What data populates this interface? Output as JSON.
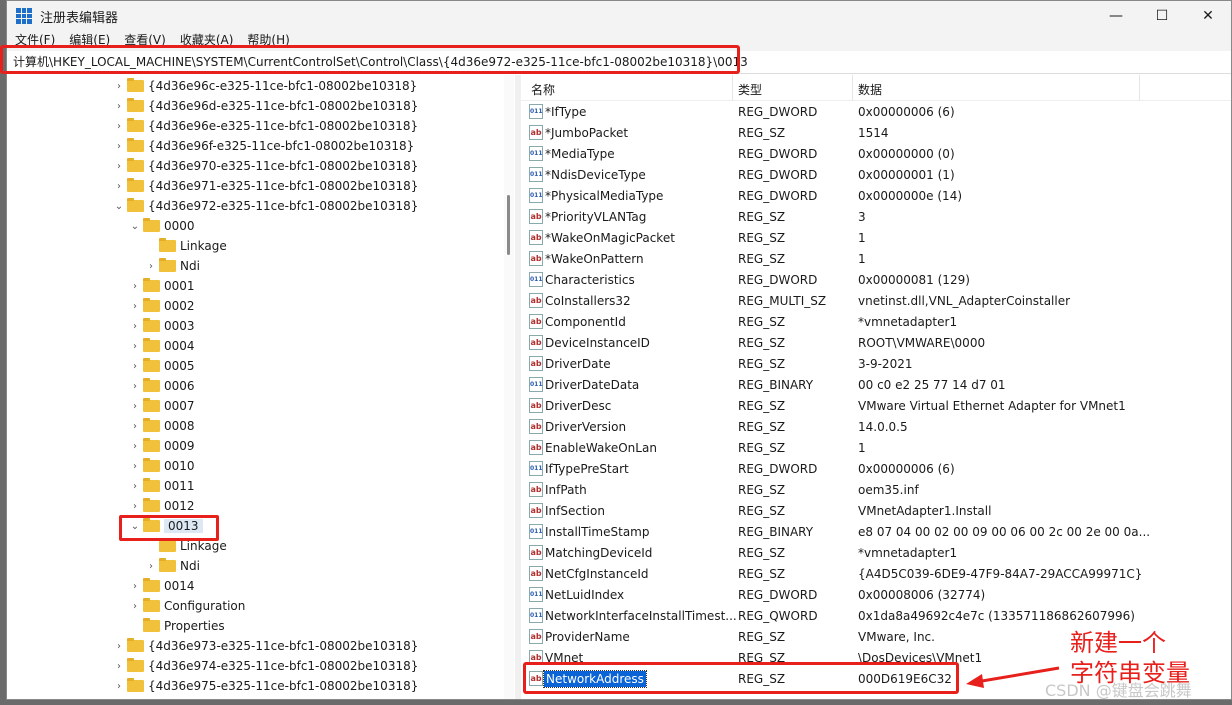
{
  "window": {
    "title": "注册表编辑器",
    "minimize": "—",
    "maximize": "☐",
    "close": "✕"
  },
  "menu": [
    "文件(F)",
    "编辑(E)",
    "查看(V)",
    "收藏夹(A)",
    "帮助(H)"
  ],
  "address": "计算机\\HKEY_LOCAL_MACHINE\\SYSTEM\\CurrentControlSet\\Control\\Class\\{4d36e972-e325-11ce-bfc1-08002be10318}\\0013",
  "tree": [
    {
      "label": "{4d36e96c-e325-11ce-bfc1-08002be10318}",
      "level": 1,
      "expanded": false
    },
    {
      "label": "{4d36e96d-e325-11ce-bfc1-08002be10318}",
      "level": 1,
      "expanded": false
    },
    {
      "label": "{4d36e96e-e325-11ce-bfc1-08002be10318}",
      "level": 1,
      "expanded": false
    },
    {
      "label": "{4d36e96f-e325-11ce-bfc1-08002be10318}",
      "level": 1,
      "expanded": false
    },
    {
      "label": "{4d36e970-e325-11ce-bfc1-08002be10318}",
      "level": 1,
      "expanded": false
    },
    {
      "label": "{4d36e971-e325-11ce-bfc1-08002be10318}",
      "level": 1,
      "expanded": false
    },
    {
      "label": "{4d36e972-e325-11ce-bfc1-08002be10318}",
      "level": 1,
      "expanded": true
    },
    {
      "label": "0000",
      "level": 2,
      "expanded": true
    },
    {
      "label": "Linkage",
      "level": 3,
      "leaf": true
    },
    {
      "label": "Ndi",
      "level": 3,
      "expanded": false
    },
    {
      "label": "0001",
      "level": 2,
      "expanded": false
    },
    {
      "label": "0002",
      "level": 2,
      "expanded": false
    },
    {
      "label": "0003",
      "level": 2,
      "expanded": false
    },
    {
      "label": "0004",
      "level": 2,
      "expanded": false
    },
    {
      "label": "0005",
      "level": 2,
      "expanded": false
    },
    {
      "label": "0006",
      "level": 2,
      "expanded": false
    },
    {
      "label": "0007",
      "level": 2,
      "expanded": false
    },
    {
      "label": "0008",
      "level": 2,
      "expanded": false
    },
    {
      "label": "0009",
      "level": 2,
      "expanded": false
    },
    {
      "label": "0010",
      "level": 2,
      "expanded": false
    },
    {
      "label": "0011",
      "level": 2,
      "expanded": false
    },
    {
      "label": "0012",
      "level": 2,
      "expanded": false
    },
    {
      "label": "0013",
      "level": 2,
      "expanded": true,
      "selected": true
    },
    {
      "label": "Linkage",
      "level": 3,
      "leaf": true
    },
    {
      "label": "Ndi",
      "level": 3,
      "expanded": false
    },
    {
      "label": "0014",
      "level": 2,
      "expanded": false
    },
    {
      "label": "Configuration",
      "level": 2,
      "expanded": false
    },
    {
      "label": "Properties",
      "level": 2,
      "leaf": true
    },
    {
      "label": "{4d36e973-e325-11ce-bfc1-08002be10318}",
      "level": 1,
      "expanded": false
    },
    {
      "label": "{4d36e974-e325-11ce-bfc1-08002be10318}",
      "level": 1,
      "expanded": false
    },
    {
      "label": "{4d36e975-e325-11ce-bfc1-08002be10318}",
      "level": 1,
      "expanded": false
    }
  ],
  "columns": {
    "name": "名称",
    "type": "类型",
    "data": "数据"
  },
  "values": [
    {
      "name": "*IfType",
      "type": "REG_DWORD",
      "data": "0x00000006 (6)"
    },
    {
      "name": "*JumboPacket",
      "type": "REG_SZ",
      "data": "1514"
    },
    {
      "name": "*MediaType",
      "type": "REG_DWORD",
      "data": "0x00000000 (0)"
    },
    {
      "name": "*NdisDeviceType",
      "type": "REG_DWORD",
      "data": "0x00000001 (1)"
    },
    {
      "name": "*PhysicalMediaType",
      "type": "REG_DWORD",
      "data": "0x0000000e (14)"
    },
    {
      "name": "*PriorityVLANTag",
      "type": "REG_SZ",
      "data": "3"
    },
    {
      "name": "*WakeOnMagicPacket",
      "type": "REG_SZ",
      "data": "1"
    },
    {
      "name": "*WakeOnPattern",
      "type": "REG_SZ",
      "data": "1"
    },
    {
      "name": "Characteristics",
      "type": "REG_DWORD",
      "data": "0x00000081 (129)"
    },
    {
      "name": "CoInstallers32",
      "type": "REG_MULTI_SZ",
      "data": "vnetinst.dll,VNL_AdapterCoinstaller"
    },
    {
      "name": "ComponentId",
      "type": "REG_SZ",
      "data": "*vmnetadapter1"
    },
    {
      "name": "DeviceInstanceID",
      "type": "REG_SZ",
      "data": "ROOT\\VMWARE\\0000"
    },
    {
      "name": "DriverDate",
      "type": "REG_SZ",
      "data": "3-9-2021"
    },
    {
      "name": "DriverDateData",
      "type": "REG_BINARY",
      "data": "00 c0 e2 25 77 14 d7 01"
    },
    {
      "name": "DriverDesc",
      "type": "REG_SZ",
      "data": "VMware Virtual Ethernet Adapter for VMnet1"
    },
    {
      "name": "DriverVersion",
      "type": "REG_SZ",
      "data": "14.0.0.5"
    },
    {
      "name": "EnableWakeOnLan",
      "type": "REG_SZ",
      "data": "1"
    },
    {
      "name": "IfTypePreStart",
      "type": "REG_DWORD",
      "data": "0x00000006 (6)"
    },
    {
      "name": "InfPath",
      "type": "REG_SZ",
      "data": "oem35.inf"
    },
    {
      "name": "InfSection",
      "type": "REG_SZ",
      "data": "VMnetAdapter1.Install"
    },
    {
      "name": "InstallTimeStamp",
      "type": "REG_BINARY",
      "data": "e8 07 04 00 02 00 09 00 06 00 2c 00 2e 00 0a..."
    },
    {
      "name": "MatchingDeviceId",
      "type": "REG_SZ",
      "data": "*vmnetadapter1"
    },
    {
      "name": "NetCfgInstanceId",
      "type": "REG_SZ",
      "data": "{A4D5C039-6DE9-47F9-84A7-29ACCA99971C}"
    },
    {
      "name": "NetLuidIndex",
      "type": "REG_DWORD",
      "data": "0x00008006 (32774)"
    },
    {
      "name": "NetworkInterfaceInstallTimest...",
      "type": "REG_QWORD",
      "data": "0x1da8a49692c4e7c (133571186862607996)"
    },
    {
      "name": "ProviderName",
      "type": "REG_SZ",
      "data": "VMware, Inc."
    },
    {
      "name": "VMnet",
      "type": "REG_SZ",
      "data": "\\DosDevices\\VMnet1"
    },
    {
      "name": "NetworkAddress",
      "type": "REG_SZ",
      "data": "000D619E6C32",
      "selected": true
    }
  ],
  "annotation": {
    "text_line1": "新建一个",
    "text_line2": "字符串变量",
    "color": "#e8201c"
  },
  "watermark": "CSDN @键盘会跳舞"
}
